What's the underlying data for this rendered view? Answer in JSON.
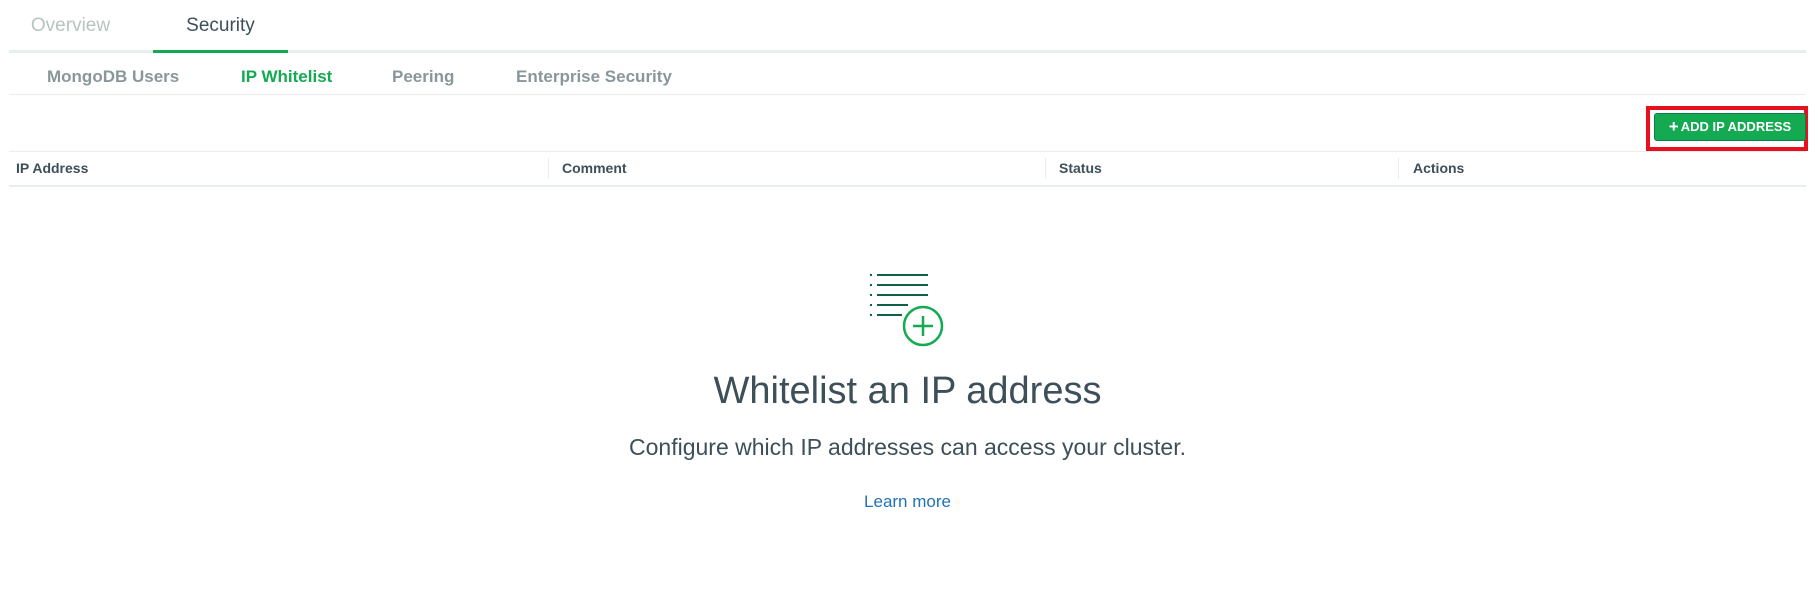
{
  "top_tabs": [
    {
      "label": "Overview",
      "active": false
    },
    {
      "label": "Security",
      "active": true
    }
  ],
  "sub_tabs": [
    {
      "label": "MongoDB Users",
      "active": false
    },
    {
      "label": "IP Whitelist",
      "active": true
    },
    {
      "label": "Peering",
      "active": false
    },
    {
      "label": "Enterprise Security",
      "active": false
    }
  ],
  "toolbar": {
    "add_button_label": "ADD IP ADDRESS",
    "add_button_icon": "plus-icon",
    "highlight_color": "#e8101e"
  },
  "table": {
    "columns": [
      "IP Address",
      "Comment",
      "Status",
      "Actions"
    ]
  },
  "empty_state": {
    "icon": "list-add-icon",
    "title": "Whitelist an IP address",
    "subtitle": "Configure which IP addresses can access your cluster.",
    "link_label": "Learn more"
  },
  "colors": {
    "accent": "#13aa52",
    "link": "#2173b8",
    "text": "#3d4f58",
    "muted": "#89979b"
  }
}
